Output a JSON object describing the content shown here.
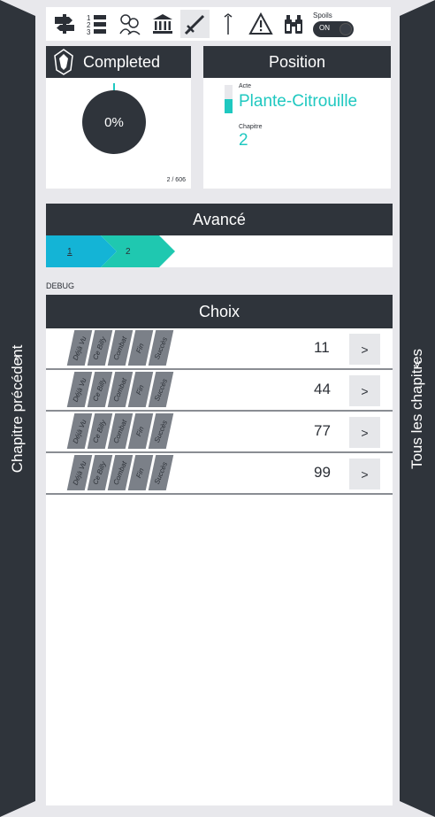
{
  "toolbar": {
    "tools": [
      {
        "icon": "signpost-icon",
        "glyph": "⚑",
        "boxed": false
      },
      {
        "icon": "numbered-list-icon",
        "glyph": "☰",
        "boxed": false
      },
      {
        "icon": "characters-icon",
        "glyph": "☺",
        "boxed": false
      },
      {
        "icon": "museum-icon",
        "glyph": "⌂",
        "boxed": false
      },
      {
        "icon": "sword-icon",
        "glyph": "⚔",
        "boxed": true
      },
      {
        "icon": "cane-icon",
        "glyph": "⎮",
        "boxed": false
      },
      {
        "icon": "warning-icon",
        "glyph": "⚠",
        "boxed": false
      },
      {
        "icon": "binoculars-icon",
        "glyph": "⛯",
        "boxed": false
      }
    ],
    "spoils_label": "Spoils",
    "spoils_state": "ON"
  },
  "rails": {
    "left_label": "Chapitre précédent",
    "left_chevron": "^",
    "right_label": "Tous les chapitres",
    "right_chevron": "v"
  },
  "completed": {
    "title": "Completed",
    "percent": "0%",
    "count": "2 / 606"
  },
  "position": {
    "title": "Position",
    "acte_label": "Acte",
    "acte_value": "Plante-Citrouille",
    "chapitre_label": "Chapitre",
    "chapitre_value": "2",
    "progress_fraction": 0.5
  },
  "avance": {
    "title": "Avancé",
    "crumbs": [
      "1",
      "2"
    ]
  },
  "debug_label": "DEBUG",
  "choix": {
    "title": "Choix",
    "tags": [
      "Déjà Vu",
      "Ce Billy",
      "Combat",
      "Fin",
      "Succès"
    ],
    "rows": [
      {
        "value": "11",
        "button": ">"
      },
      {
        "value": "44",
        "button": ">"
      },
      {
        "value": "77",
        "button": ">"
      },
      {
        "value": "99",
        "button": ">"
      }
    ]
  },
  "colors": {
    "dark": "#2f343b",
    "accent": "#1fc8c0",
    "crumb_blue": "#14b4d6",
    "crumb_green": "#1fc8b0"
  }
}
